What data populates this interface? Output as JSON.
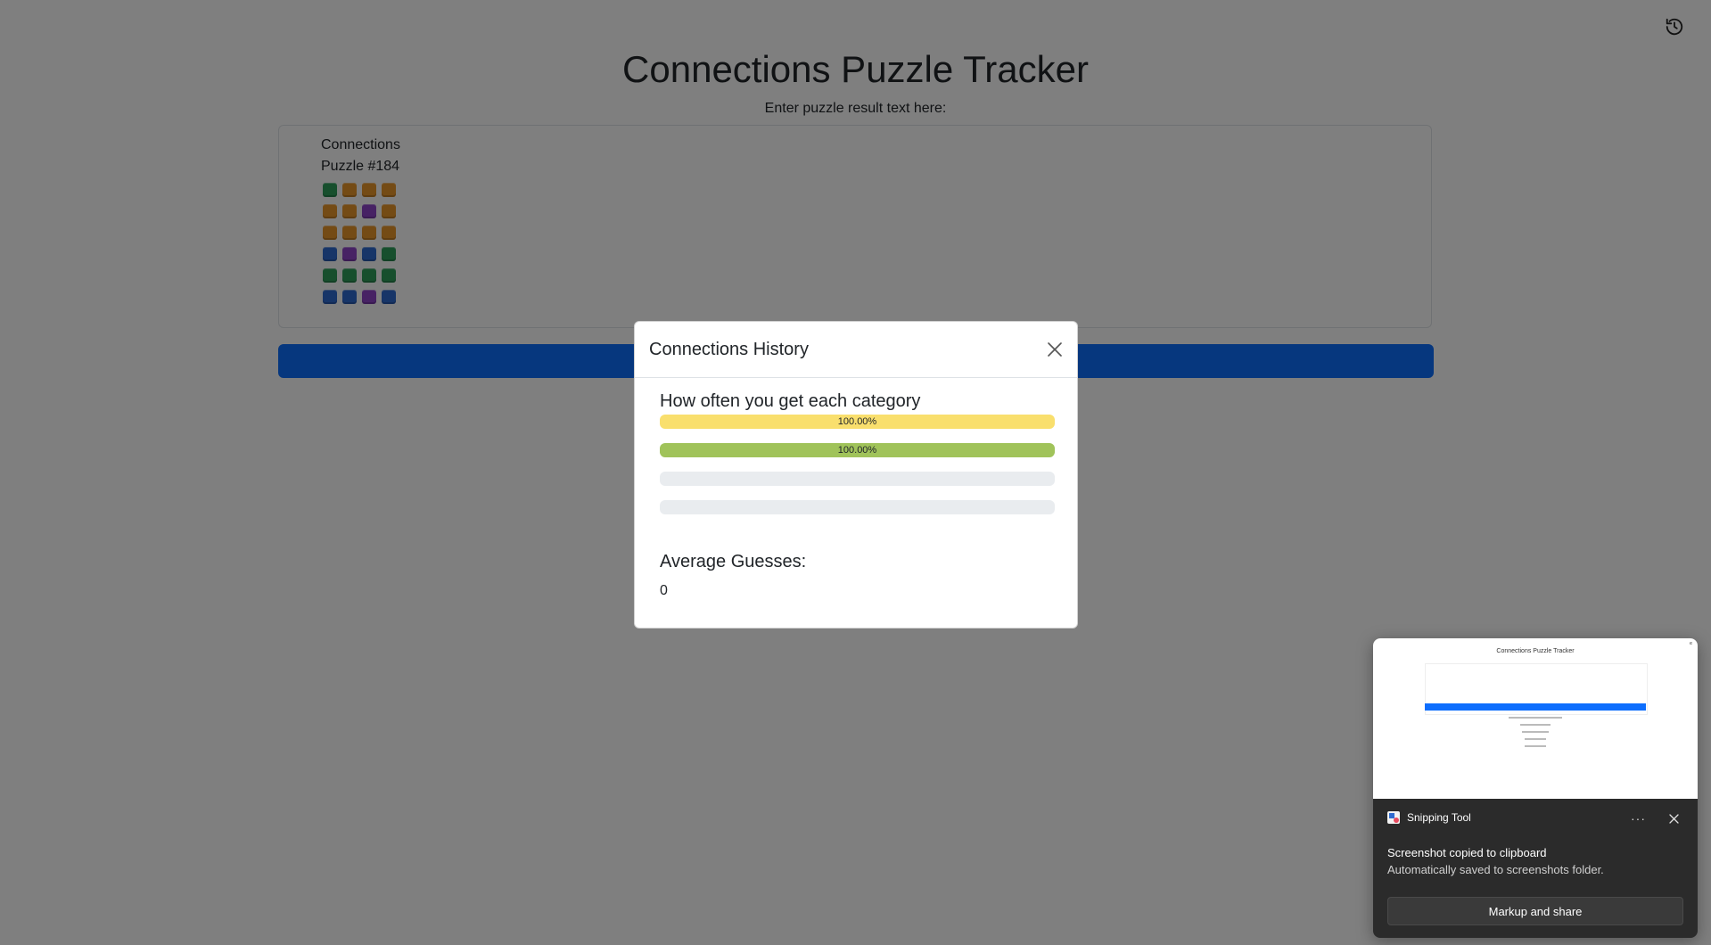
{
  "page": {
    "title": "Connections Puzzle Tracker",
    "prompt_label": "Enter puzzle result text here:",
    "history_icon": "history-icon"
  },
  "textarea": {
    "line1": "Connections",
    "line2": "Puzzle #184",
    "grid": [
      [
        "green",
        "orange",
        "orange",
        "orange"
      ],
      [
        "orange",
        "orange",
        "purple",
        "orange"
      ],
      [
        "orange",
        "orange",
        "orange",
        "orange"
      ],
      [
        "blue",
        "purple",
        "blue",
        "green"
      ],
      [
        "green",
        "green",
        "green",
        "green"
      ],
      [
        "blue",
        "blue",
        "purple",
        "blue"
      ]
    ]
  },
  "colors": {
    "green": "#2e9e5b",
    "orange": "#e8962a",
    "purple": "#8e44c9",
    "blue": "#2f6bd0",
    "submit": "#0d6efd",
    "bar_yellow": "#f9df6d",
    "bar_green": "#a0c35a",
    "bar_track": "#e9ecef"
  },
  "modal": {
    "title": "Connections History",
    "close_icon": "close-icon",
    "section_title": "How often you get each category",
    "bars": [
      {
        "label": "100.00%",
        "value": 1.0,
        "color": "#f9df6d"
      },
      {
        "label": "100.00%",
        "value": 1.0,
        "color": "#a0c35a"
      },
      {
        "label": "",
        "value": 0.0,
        "color": "#b0c4ef"
      },
      {
        "label": "",
        "value": 0.0,
        "color": "#ba81c5"
      }
    ],
    "avg_title": "Average Guesses:",
    "avg_value": "0"
  },
  "toast": {
    "app_name": "Snipping Tool",
    "more": "···",
    "message": "Screenshot copied to clipboard",
    "sub": "Automatically saved to screenshots folder.",
    "button": "Markup and share",
    "preview_title": "Connections Puzzle Tracker"
  }
}
